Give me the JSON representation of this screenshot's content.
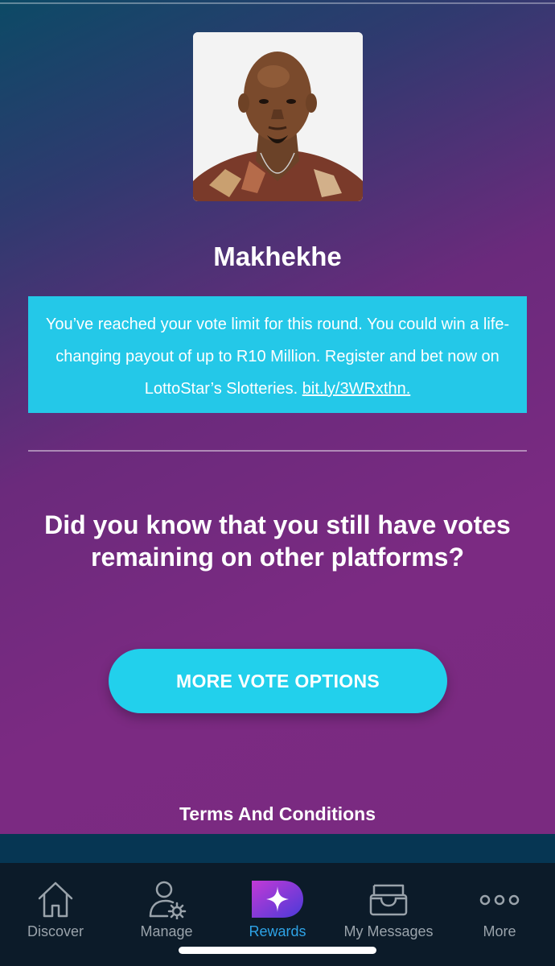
{
  "contestant": {
    "name": "Makhekhe",
    "photo_alt": "Makhekhe"
  },
  "notice": {
    "text": "You’ve reached your vote limit for this round. You could win a life-changing payout of up to R10 Million. Register and bet now on LottoStar’s Slotteries.",
    "link_text": "bit.ly/3WRxthn."
  },
  "question": "Did you know that you still have votes remaining on other platforms?",
  "more_votes_button": "MORE VOTE OPTIONS",
  "terms_link": "Terms And Conditions",
  "tabs": [
    {
      "label": "Discover",
      "icon": "home-icon",
      "active": false
    },
    {
      "label": "Manage",
      "icon": "user-gear-icon",
      "active": false
    },
    {
      "label": "Rewards",
      "icon": "rewards-d-icon",
      "active": true
    },
    {
      "label": "My Messages",
      "icon": "inbox-icon",
      "active": false
    },
    {
      "label": "More",
      "icon": "more-dots-icon",
      "active": false
    }
  ],
  "colors": {
    "accent_cyan": "#22d0ec",
    "tab_active": "#2ea3e6",
    "tab_inactive": "#9aa3ab"
  }
}
